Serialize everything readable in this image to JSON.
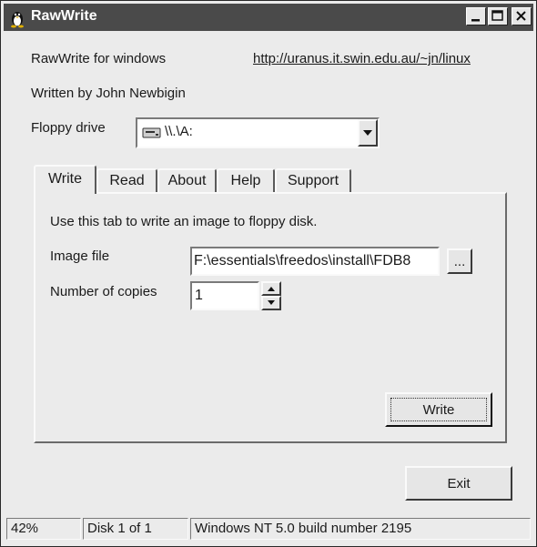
{
  "window": {
    "title": "RawWrite",
    "accent": "#4a4a4a"
  },
  "header": {
    "app_name": "RawWrite for windows",
    "url": "http://uranus.it.swin.edu.au/~jn/linux",
    "author": "Written by John Newbigin"
  },
  "drive": {
    "label": "Floppy drive",
    "selected": "\\\\.\\A:"
  },
  "tabs": [
    {
      "label": "Write",
      "active": true
    },
    {
      "label": "Read",
      "active": false
    },
    {
      "label": "About",
      "active": false
    },
    {
      "label": "Help",
      "active": false
    },
    {
      "label": "Support",
      "active": false
    }
  ],
  "write_tab": {
    "description": "Use this tab to write an image to floppy disk.",
    "image_label": "Image file",
    "image_value": "F:\\essentials\\freedos\\install\\FDB8",
    "browse_label": "...",
    "copies_label": "Number of copies",
    "copies_value": "1",
    "write_button": "Write"
  },
  "exit_button": "Exit",
  "statusbar": {
    "progress": "42%",
    "disk": "Disk 1 of 1",
    "os": "Windows NT 5.0 build number 2195"
  }
}
